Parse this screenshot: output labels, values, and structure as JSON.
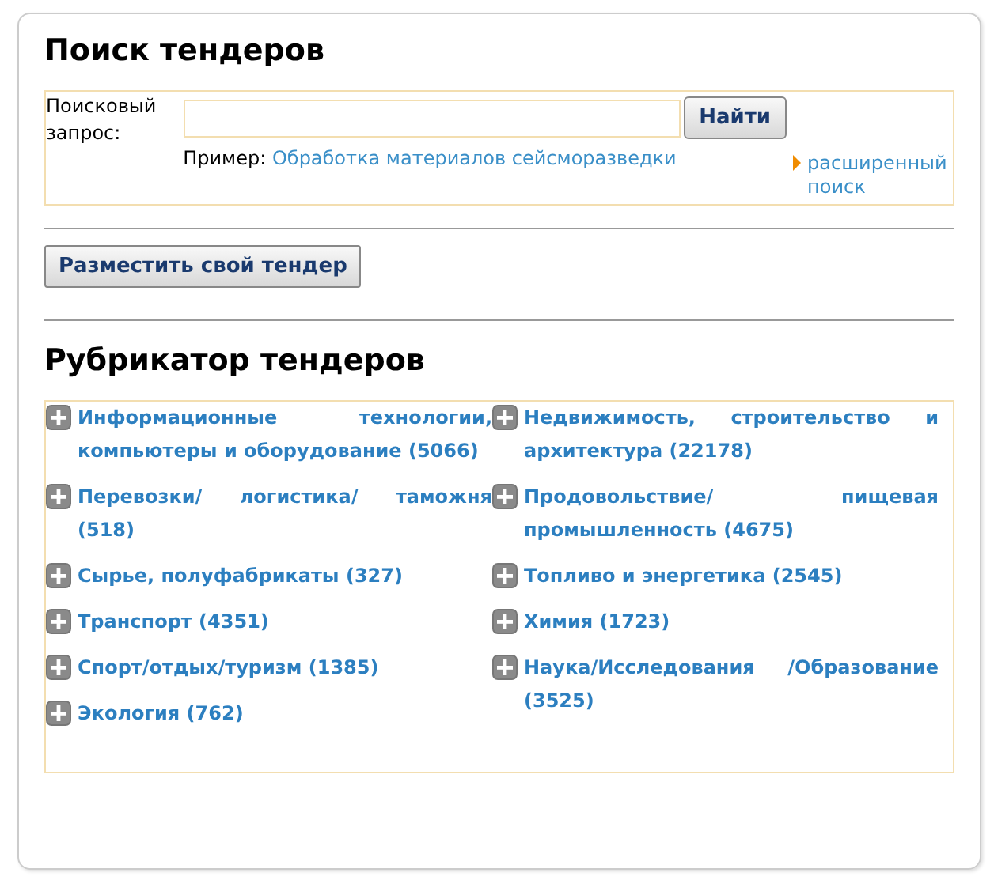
{
  "title": "Поиск тендеров",
  "search": {
    "label": "Поисковый запрос:",
    "button": "Найти",
    "example_label": "Пример:",
    "example_links": [
      "Обработка материалов",
      "сейсморазведки"
    ],
    "advanced_link": "расширенный поиск"
  },
  "post_button": "Разместить свой тендер",
  "rubricator": {
    "title": "Рубрикатор тендеров",
    "columns": [
      [
        "Информационные технологии, компьютеры и оборудование (5066)",
        "Перевозки/ логистика/ таможня (518)",
        "Сырье, полуфабрикаты (327)",
        "Транспорт (4351)",
        "Спорт/отдых/туризм (1385)",
        "Экология (762)"
      ],
      [
        "Недвижимость, строительство и архитектура (22178)",
        "Продовольствие/ пищевая промышленность (4675)",
        "Топливо и энергетика (2545)",
        "Химия (1723)",
        "Наука/Исследования /Образование (3525)"
      ]
    ]
  }
}
